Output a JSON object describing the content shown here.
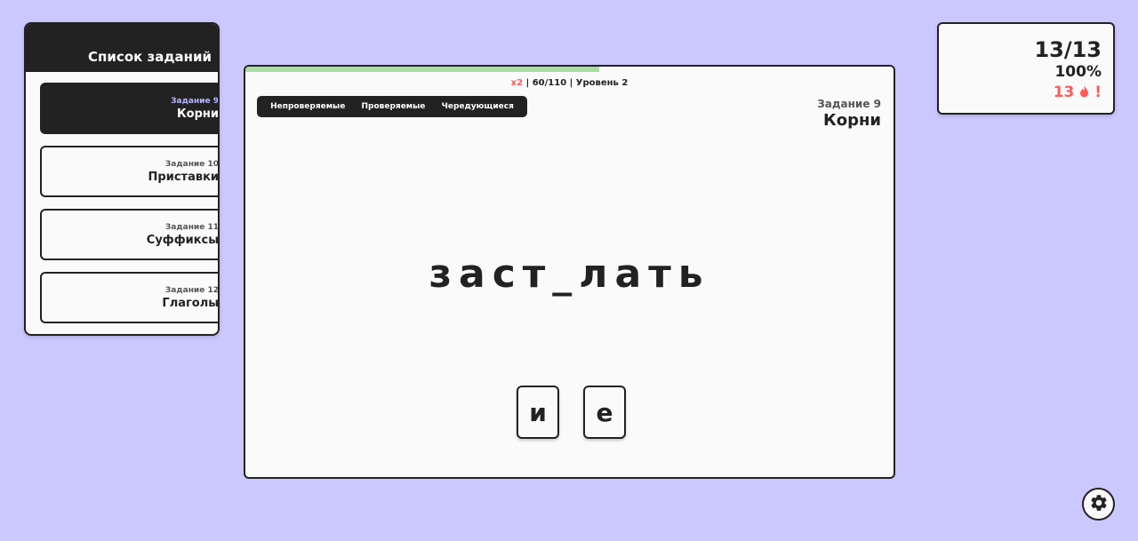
{
  "sidebar": {
    "title": "Список заданий",
    "items": [
      {
        "num": "Задание 9",
        "title": "Корни",
        "active": true
      },
      {
        "num": "Задание 10",
        "title": "Приставки"
      },
      {
        "num": "Задание 11",
        "title": "Суффиксы"
      },
      {
        "num": "Задание 12",
        "title": "Глаголы"
      }
    ]
  },
  "main": {
    "progress": {
      "current": 60,
      "total": 110
    },
    "status": {
      "multiplier": "x2",
      "progress_text": "60/110",
      "level": "Уровень 2"
    },
    "tabs": [
      "Непроверяемые",
      "Проверяемые",
      "Чередующиеся"
    ],
    "task_num": "Задание 9",
    "task_title": "Корни",
    "word": "заст_лать",
    "choices": [
      "и",
      "е"
    ]
  },
  "score": {
    "count": "13/13",
    "percent": "100%",
    "streak": "13",
    "streak_suffix": "!",
    "streak_icon": "fire-icon"
  },
  "settings": {
    "icon": "gear-icon"
  },
  "colors": {
    "background": "#cbc8ff",
    "dark": "#222222",
    "panel": "#fafafa",
    "progress": "#a8dea0",
    "accent_red": "#ff5b5b",
    "active_num": "#b9b5ff"
  }
}
